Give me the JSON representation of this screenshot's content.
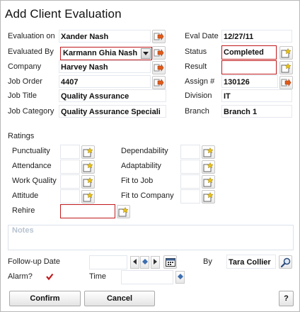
{
  "title": "Add Client Evaluation",
  "fields": {
    "evaluation_on": {
      "label": "Evaluation on",
      "value": "Xander Nash"
    },
    "evaluated_by": {
      "label": "Evaluated By",
      "value": "Karmann Ghia Nash"
    },
    "company": {
      "label": "Company",
      "value": "Harvey Nash"
    },
    "job_order": {
      "label": "Job Order",
      "value": "4407"
    },
    "job_title": {
      "label": "Job Title",
      "value": "Quality Assurance"
    },
    "job_category": {
      "label": "Job Category",
      "value": "Quality Assurance Speciali"
    },
    "eval_date": {
      "label": "Eval Date",
      "value": "12/27/11"
    },
    "status": {
      "label": "Status",
      "value": "Completed"
    },
    "result": {
      "label": "Result",
      "value": ""
    },
    "assign": {
      "label": "Assign #",
      "value": "130126"
    },
    "division": {
      "label": "Division",
      "value": "IT"
    },
    "branch": {
      "label": "Branch",
      "value": "Branch 1"
    }
  },
  "ratings": {
    "heading": "Ratings",
    "left": [
      "Punctuality",
      "Attendance",
      "Work Quality",
      "Attitude"
    ],
    "right": [
      "Dependability",
      "Adaptability",
      "Fit to Job",
      "Fit to Company"
    ],
    "rehire": "Rehire"
  },
  "notes_placeholder": "Notes",
  "followup": {
    "label": "Follow-up Date",
    "by_label": "By",
    "by_value": "Tara Collier",
    "alarm_label": "Alarm?",
    "alarm_checked": true,
    "time_label": "Time"
  },
  "buttons": {
    "confirm": "Confirm",
    "cancel": "Cancel",
    "help": "?"
  },
  "colors": {
    "required_border": "#c0191c",
    "checkmark": "#c0191c",
    "lookup_arrow": "#e05a1a",
    "pick_icon": "#e8c21a"
  },
  "icons": {
    "lookup": "lookup-arrow-icon",
    "pick": "pick-list-icon",
    "search": "magnifier-icon",
    "calendar": "calendar-icon"
  }
}
